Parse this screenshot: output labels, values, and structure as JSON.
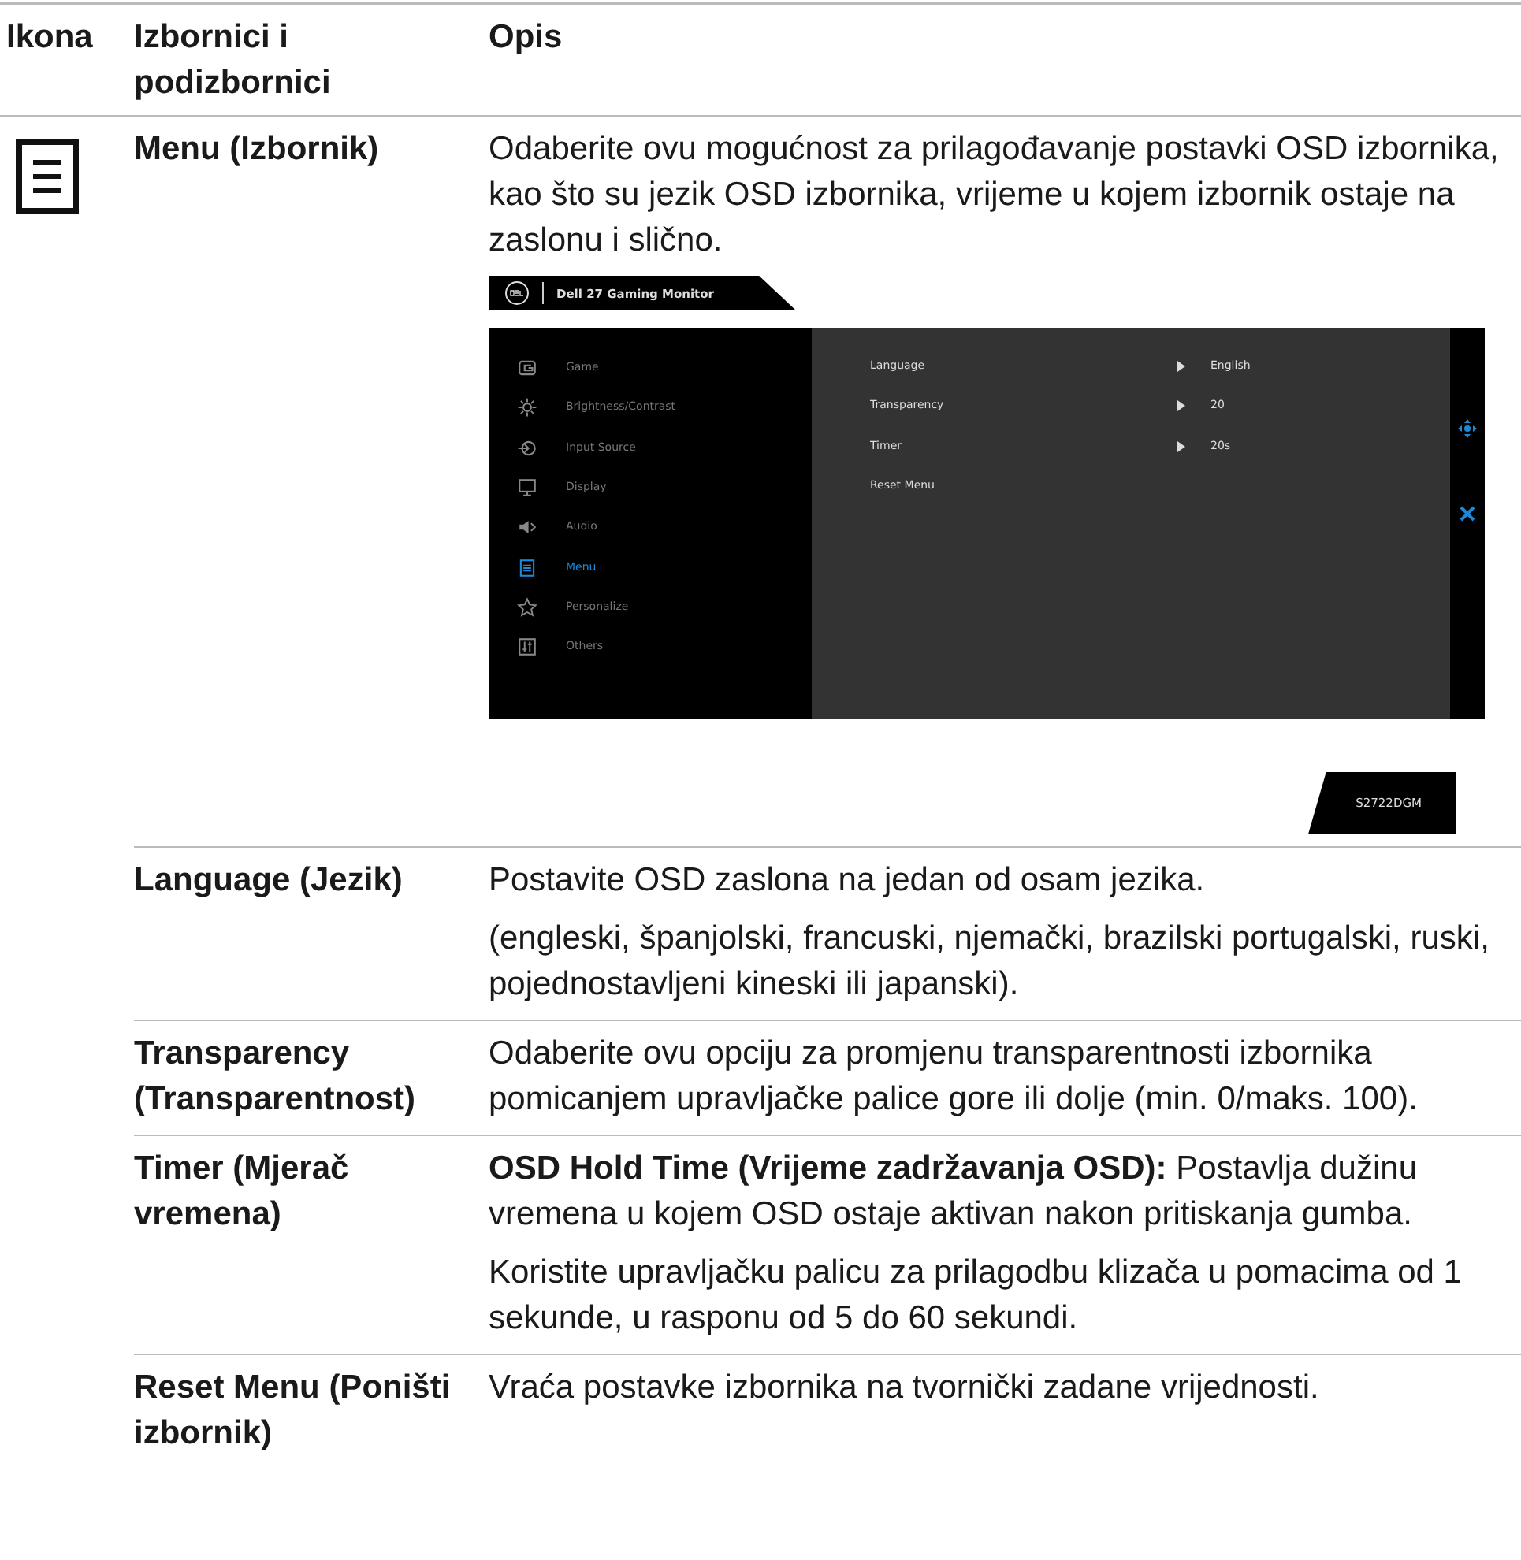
{
  "columns": [
    "Ikona",
    "Izbornici i podizbornici",
    "Opis"
  ],
  "rows": [
    {
      "menu": "Menu (Izbornik)",
      "description": [
        "Odaberite ovu mogućnost za prilagođavanje postavki OSD izbornika, kao što su jezik OSD izbornika, vrijeme u kojem izbornik ostaje na zaslonu i slično."
      ],
      "osd": {
        "title": "Dell 27 Gaming Monitor",
        "nav": [
          {
            "label": "Game",
            "selected": false
          },
          {
            "label": "Brightness/Contrast",
            "selected": false
          },
          {
            "label": "Input Source",
            "selected": false
          },
          {
            "label": "Display",
            "selected": false
          },
          {
            "label": "Audio",
            "selected": false
          },
          {
            "label": "Menu",
            "selected": true
          },
          {
            "label": "Personalize",
            "selected": false
          },
          {
            "label": "Others",
            "selected": false
          }
        ],
        "settings": [
          {
            "label": "Language",
            "value": "English"
          },
          {
            "label": "Transparency",
            "value": "20"
          },
          {
            "label": "Timer",
            "value": "20s"
          },
          {
            "label": "Reset Menu"
          }
        ],
        "model": "S2722DGM"
      }
    },
    {
      "menu": "Language (Jezik)",
      "description": [
        "Postavite OSD zaslona na jedan od osam jezika.",
        "(engleski, španjolski, francuski, njemački, brazilski portugalski, ruski, pojednostavljeni kineski ili japanski)."
      ]
    },
    {
      "menu": "Transparency (Transparentnost)",
      "description": [
        "Odaberite ovu opciju za promjenu transparentnosti izbornika pomicanjem upravljačke palice gore ili dolje (min. 0/maks. 100)."
      ]
    },
    {
      "menu": "Timer (Mjerač vremena)",
      "description": [
        "**OSD Hold Time (Vrijeme zadržavanja OSD):** Postavlja dužinu vremena u kojem OSD ostaje aktivan nakon pritiskanja gumba.",
        "Koristite upravljačku palicu za prilagodbu klizača u pomacima od 1 sekunde, u rasponu od 5 do 60 sekundi."
      ]
    },
    {
      "menu": "Reset Menu (Poništi izbornik)",
      "description": [
        "Vraća postavke izbornika na tvornički zadane vrijednosti."
      ]
    }
  ]
}
